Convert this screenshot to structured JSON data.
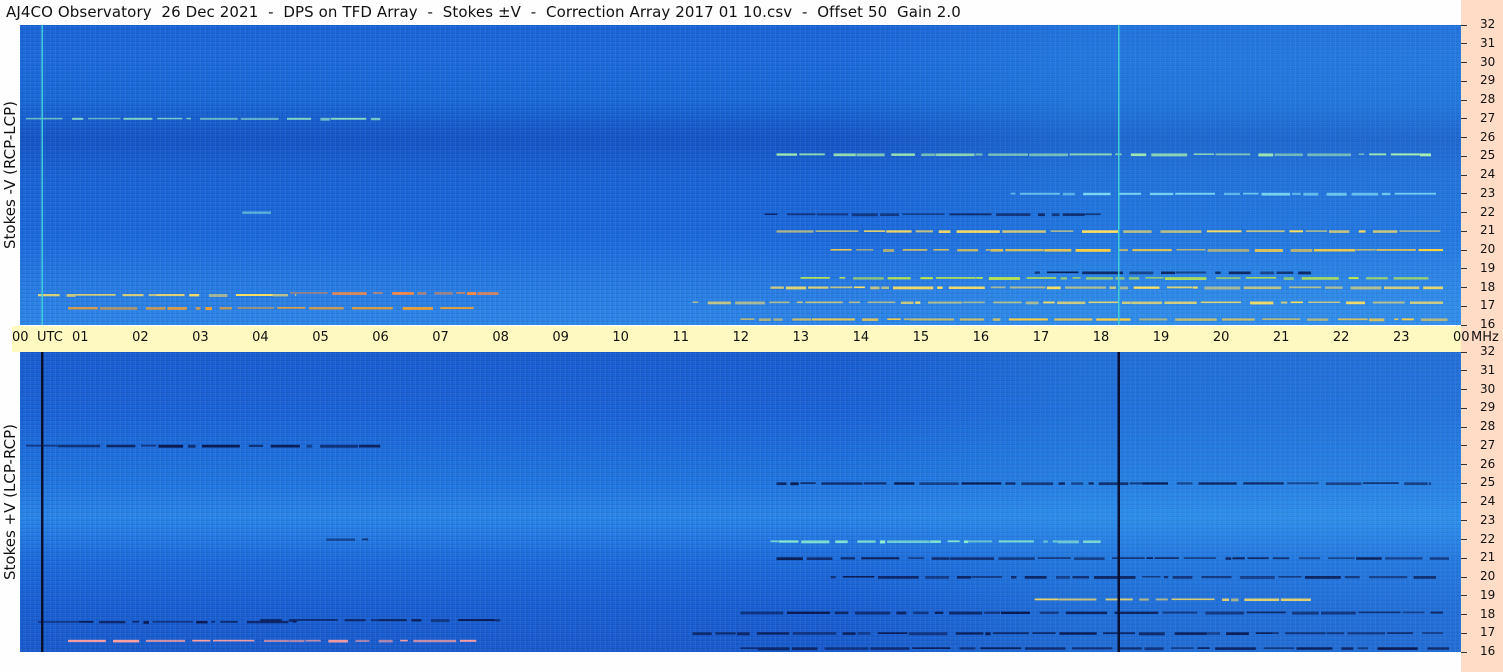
{
  "title": "AJ4CO Observatory  26 Dec 2021  -  DPS on TFD Array  -  Stokes ±V  -  Correction Array 2017 01 10.csv  -  Offset 50  Gain 2.0",
  "colors": {
    "background": "#1a64d8",
    "time_axis": "#fef9c0",
    "right_strip": "#ffdcc6"
  },
  "chart_data": [
    {
      "type": "heatmap",
      "panel": "top",
      "ylabel": "Stokes -V (RCP-LCP)",
      "x_ticks": [
        "00",
        "01",
        "02",
        "03",
        "04",
        "05",
        "06",
        "07",
        "08",
        "09",
        "10",
        "11",
        "12",
        "13",
        "14",
        "15",
        "16",
        "17",
        "18",
        "19",
        "20",
        "21",
        "22",
        "23",
        "00"
      ],
      "x_unit": "UTC",
      "y_ticks": [
        "16",
        "17",
        "18",
        "19",
        "20",
        "21",
        "22",
        "23",
        "24",
        "25",
        "26",
        "27",
        "28",
        "29",
        "30",
        "31",
        "32"
      ],
      "y_unit": "MHz",
      "xlim": [
        0,
        24
      ],
      "ylim": [
        16,
        32
      ],
      "vertical_markers_utc": [
        0.37,
        18.3
      ],
      "bands": [
        {
          "f": 27.0,
          "t0": 0.1,
          "t1": 6.0,
          "color": "#8fe6c8"
        },
        {
          "f": 25.1,
          "t0": 12.6,
          "t1": 23.5,
          "color": "#a8f0b0"
        },
        {
          "f": 23.0,
          "t0": 16.5,
          "t1": 23.6,
          "color": "#7fd8f0"
        },
        {
          "f": 22.0,
          "t0": 3.7,
          "t1": 4.3,
          "color": "#8ff0e0"
        },
        {
          "f": 21.9,
          "t0": 12.4,
          "t1": 18.0,
          "color": "#0a1a50"
        },
        {
          "f": 21.0,
          "t0": 12.6,
          "t1": 23.8,
          "color": "#ffe060"
        },
        {
          "f": 20.0,
          "t0": 13.5,
          "t1": 23.7,
          "color": "#ffd040"
        },
        {
          "f": 18.8,
          "t0": 16.9,
          "t1": 21.5,
          "color": "#0a1a50"
        },
        {
          "f": 18.5,
          "t0": 13.0,
          "t1": 23.5,
          "color": "#c8f040"
        },
        {
          "f": 18.0,
          "t0": 12.5,
          "t1": 23.7,
          "color": "#ffe060"
        },
        {
          "f": 17.7,
          "t0": 4.5,
          "t1": 8.0,
          "color": "#ff8a40"
        },
        {
          "f": 17.6,
          "t0": 0.3,
          "t1": 4.6,
          "color": "#ffe060"
        },
        {
          "f": 17.2,
          "t0": 11.2,
          "t1": 23.7,
          "color": "#ffe060"
        },
        {
          "f": 16.9,
          "t0": 0.8,
          "t1": 7.6,
          "color": "#f0a030"
        },
        {
          "f": 16.3,
          "t0": 12.0,
          "t1": 23.8,
          "color": "#ffd040"
        }
      ]
    },
    {
      "type": "heatmap",
      "panel": "bottom",
      "ylabel": "Stokes +V (LCP-RCP)",
      "x_ticks": [
        "00",
        "01",
        "02",
        "03",
        "04",
        "05",
        "06",
        "07",
        "08",
        "09",
        "10",
        "11",
        "12",
        "13",
        "14",
        "15",
        "16",
        "17",
        "18",
        "19",
        "20",
        "21",
        "22",
        "23",
        "00"
      ],
      "x_unit": "UTC",
      "y_ticks": [
        "16",
        "17",
        "18",
        "19",
        "20",
        "21",
        "22",
        "23",
        "24",
        "25",
        "26",
        "27",
        "28",
        "29",
        "30",
        "31",
        "32"
      ],
      "y_unit": "MHz",
      "xlim": [
        0,
        24
      ],
      "ylim": [
        16,
        32
      ],
      "vertical_markers_utc": [
        0.37,
        18.3
      ],
      "bands": [
        {
          "f": 27.0,
          "t0": 0.1,
          "t1": 6.0,
          "color": "#0a1a50"
        },
        {
          "f": 25.0,
          "t0": 12.6,
          "t1": 23.5,
          "color": "#0a1a50"
        },
        {
          "f": 22.0,
          "t0": 5.1,
          "t1": 5.8,
          "color": "#0a1a50"
        },
        {
          "f": 21.9,
          "t0": 12.5,
          "t1": 18.0,
          "color": "#90f0d0"
        },
        {
          "f": 21.0,
          "t0": 12.6,
          "t1": 23.8,
          "color": "#0a1a50"
        },
        {
          "f": 20.0,
          "t0": 13.5,
          "t1": 23.7,
          "color": "#0a1a50"
        },
        {
          "f": 18.8,
          "t0": 16.9,
          "t1": 21.5,
          "color": "#ffe060"
        },
        {
          "f": 18.1,
          "t0": 12.0,
          "t1": 23.7,
          "color": "#0a1a50"
        },
        {
          "f": 17.7,
          "t0": 4.0,
          "t1": 8.0,
          "color": "#0a1a50"
        },
        {
          "f": 17.6,
          "t0": 0.3,
          "t1": 4.6,
          "color": "#0a1a50"
        },
        {
          "f": 17.0,
          "t0": 11.2,
          "t1": 23.7,
          "color": "#0a1a50"
        },
        {
          "f": 16.6,
          "t0": 0.8,
          "t1": 7.6,
          "color": "#ffa0a0"
        },
        {
          "f": 16.2,
          "t0": 12.0,
          "t1": 23.8,
          "color": "#0a1a50"
        }
      ]
    }
  ]
}
